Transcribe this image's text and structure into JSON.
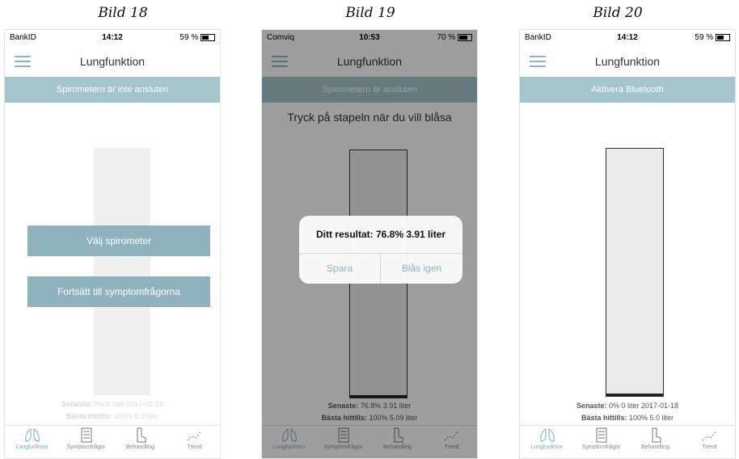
{
  "captions": [
    "Bild 18",
    "Bild 19",
    "Bild 20"
  ],
  "screens": [
    {
      "status": {
        "carrier": "BankID",
        "time": "14:12",
        "right": "59 %"
      },
      "nav_title": "Lungfunktion",
      "banner": "Spirometern är inte ansluten",
      "buttons": [
        "Välj spirometer",
        "Fortsätt till symptomfrågorna"
      ],
      "stats": {
        "last_label": "Senaste:",
        "last_value": "0% 0 liter 2017-01-18",
        "best_label": "Bästa hittills:",
        "best_value": "100% 5.0 liter"
      }
    },
    {
      "status": {
        "carrier": "Comviq",
        "time": "10:53",
        "right": "70 %"
      },
      "nav_title": "Lungfunktion",
      "banner": "Spirometern är ansluten",
      "instruction": "Tryck på stapeln när du vill blåsa",
      "dialog": {
        "message": "Ditt resultat: 76.8% 3.91 liter",
        "save": "Spara",
        "retry": "Blås igen"
      },
      "stats": {
        "last_label": "Senaste:",
        "last_value": "76.8% 3.91 liter",
        "best_label": "Bästa hittills:",
        "best_value": "100% 5.09 liter"
      }
    },
    {
      "status": {
        "carrier": "BankID",
        "time": "14:12",
        "right": "59 %"
      },
      "nav_title": "Lungfunktion",
      "banner": "Aktivera Bluetooth",
      "stats": {
        "last_label": "Senaste:",
        "last_value": "0% 0 liter 2017-01-18",
        "best_label": "Bästa hittills:",
        "best_value": "100% 5.0 liter"
      }
    }
  ],
  "tabs": [
    "Lungfunktion",
    "Symptomfrågor",
    "Behandling",
    "Trend"
  ],
  "colors": {
    "accent": "#8fb3bd",
    "banner": "#a3c6cd",
    "overlay": "rgba(0,0,0,0.38)"
  }
}
